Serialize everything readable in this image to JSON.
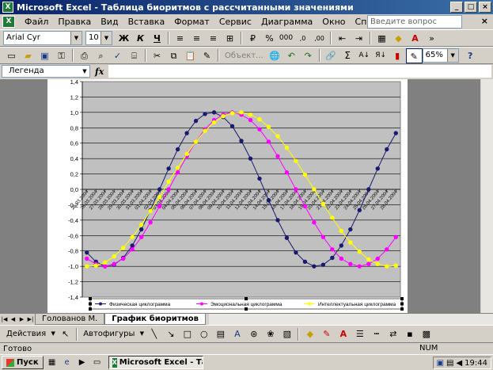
{
  "window": {
    "title": "Microsoft Excel - Таблица биоритмов с рассчитанными значениями"
  },
  "menu": {
    "items": [
      "Файл",
      "Правка",
      "Вид",
      "Вставка",
      "Формат",
      "Сервис",
      "Диаграмма",
      "Окно",
      "Справка"
    ],
    "help_placeholder": "Введите вопрос"
  },
  "toolbar1": {
    "font": "Arial Cyr",
    "size": "10"
  },
  "toolbar2": {
    "object_label": "Объект...",
    "zoom": "65%"
  },
  "formula": {
    "name_box": "Легенда",
    "fx": "fx"
  },
  "chart_data": {
    "type": "line",
    "ylim": [
      -1.4,
      1.4
    ],
    "y_ticks": [
      "1,4",
      "1,2",
      "1,0",
      "0,8",
      "0,6",
      "0,4",
      "0,2",
      "0,0",
      "-0,2",
      "-0,4",
      "-0,6",
      "-0,8",
      "-1,0",
      "-1,2",
      "-1,4"
    ],
    "categories": [
      "25.03.2004",
      "26.03.2004",
      "27.03.2004",
      "28.03.2004",
      "29.03.2004",
      "30.03.2004",
      "31.03.2004",
      "01.04.2004",
      "02.04.2004",
      "03.04.2004",
      "04.04.2004",
      "05.04.2004",
      "06.04.2004",
      "07.04.2004",
      "08.04.2004",
      "09.04.2004",
      "10.04.2004",
      "11.04.2004",
      "12.04.2004",
      "13.04.2004",
      "14.04.2004",
      "15.04.2004",
      "16.04.2004",
      "17.04.2004",
      "18.04.2004",
      "19.04.2004",
      "20.04.2004",
      "21.04.2004",
      "22.04.2004",
      "23.04.2004",
      "24.04.2004",
      "25.04.2004",
      "26.04.2004",
      "27.04.2004",
      "28.04.2004"
    ],
    "series": [
      {
        "name": "Физическая циклограмма",
        "color": "#1a1a6e",
        "values": [
          -0.82,
          -0.94,
          -1.0,
          -0.98,
          -0.89,
          -0.73,
          -0.52,
          -0.27,
          0.0,
          0.27,
          0.52,
          0.73,
          0.89,
          0.98,
          1.0,
          0.94,
          0.82,
          0.63,
          0.4,
          0.14,
          -0.14,
          -0.4,
          -0.63,
          -0.82,
          -0.94,
          -1.0,
          -0.98,
          -0.89,
          -0.73,
          -0.52,
          -0.27,
          0.0,
          0.27,
          0.52,
          0.73
        ]
      },
      {
        "name": "Эмоциональная циклограмма",
        "color": "#ff00ff",
        "values": [
          -0.9,
          -0.97,
          -1.0,
          -0.97,
          -0.9,
          -0.78,
          -0.62,
          -0.43,
          -0.22,
          0.0,
          0.22,
          0.43,
          0.62,
          0.78,
          0.9,
          0.97,
          1.0,
          0.97,
          0.9,
          0.78,
          0.62,
          0.43,
          0.22,
          0.0,
          -0.22,
          -0.43,
          -0.62,
          -0.78,
          -0.9,
          -0.97,
          -1.0,
          -0.97,
          -0.9,
          -0.78,
          -0.62
        ]
      },
      {
        "name": "Интеллектуальная циклограмма",
        "color": "#ffff00",
        "values": [
          -1.0,
          -0.99,
          -0.95,
          -0.87,
          -0.76,
          -0.62,
          -0.46,
          -0.28,
          -0.1,
          0.1,
          0.28,
          0.46,
          0.62,
          0.76,
          0.87,
          0.95,
          0.99,
          1.0,
          0.97,
          0.91,
          0.81,
          0.69,
          0.54,
          0.37,
          0.19,
          0.0,
          -0.19,
          -0.37,
          -0.54,
          -0.69,
          -0.81,
          -0.91,
          -0.97,
          -1.0,
          -0.99
        ]
      }
    ]
  },
  "tabs": {
    "inactive": "Голованов М.",
    "active": "График биоритмов"
  },
  "drawing": {
    "actions": "Действия",
    "autoshapes": "Автофигуры"
  },
  "status": {
    "ready": "Готово",
    "num": "NUM"
  },
  "taskbar": {
    "start": "Пуск",
    "task": "Microsoft Excel - Таб...",
    "clock": "19:44"
  }
}
